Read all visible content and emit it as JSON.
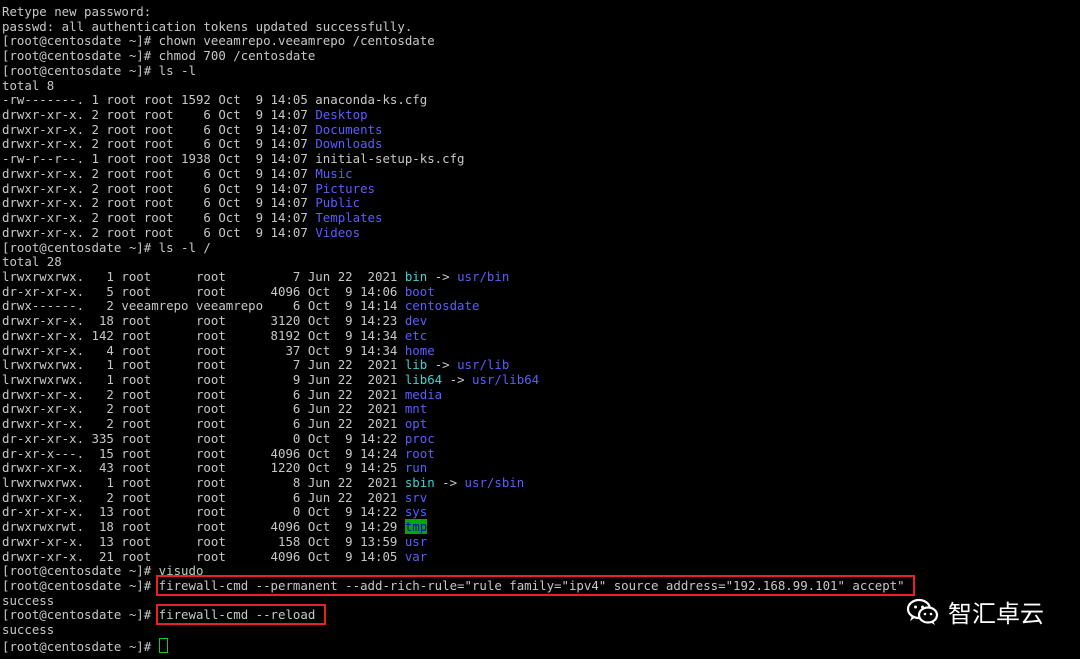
{
  "terminal": {
    "lines": [
      [
        {
          "t": "Retype new password:"
        }
      ],
      [
        {
          "t": "passwd: all authentication tokens updated successfully."
        }
      ],
      [
        {
          "t": "[root@centosdate ~]# chown veeamrepo.veeamrepo /centosdate"
        }
      ],
      [
        {
          "t": "[root@centosdate ~]# chmod 700 /centosdate"
        }
      ],
      [
        {
          "t": "[root@centosdate ~]# ls -l"
        }
      ],
      [
        {
          "t": "total 8"
        }
      ],
      [
        {
          "t": "-rw-------. 1 root root 1592 Oct  9 14:05 anaconda-ks.cfg"
        }
      ],
      [
        {
          "t": "drwxr-xr-x. 2 root root    6 Oct  9 14:07 "
        },
        {
          "t": "Desktop",
          "c": "dir"
        }
      ],
      [
        {
          "t": "drwxr-xr-x. 2 root root    6 Oct  9 14:07 "
        },
        {
          "t": "Documents",
          "c": "dir"
        }
      ],
      [
        {
          "t": "drwxr-xr-x. 2 root root    6 Oct  9 14:07 "
        },
        {
          "t": "Downloads",
          "c": "dir"
        }
      ],
      [
        {
          "t": "-rw-r--r--. 1 root root 1938 Oct  9 14:07 initial-setup-ks.cfg"
        }
      ],
      [
        {
          "t": "drwxr-xr-x. 2 root root    6 Oct  9 14:07 "
        },
        {
          "t": "Music",
          "c": "dir"
        }
      ],
      [
        {
          "t": "drwxr-xr-x. 2 root root    6 Oct  9 14:07 "
        },
        {
          "t": "Pictures",
          "c": "dir"
        }
      ],
      [
        {
          "t": "drwxr-xr-x. 2 root root    6 Oct  9 14:07 "
        },
        {
          "t": "Public",
          "c": "dir"
        }
      ],
      [
        {
          "t": "drwxr-xr-x. 2 root root    6 Oct  9 14:07 "
        },
        {
          "t": "Templates",
          "c": "dir"
        }
      ],
      [
        {
          "t": "drwxr-xr-x. 2 root root    6 Oct  9 14:07 "
        },
        {
          "t": "Videos",
          "c": "dir"
        }
      ],
      [
        {
          "t": "[root@centosdate ~]# ls -l /"
        }
      ],
      [
        {
          "t": "total 28"
        }
      ],
      [
        {
          "t": "lrwxrwxrwx.   1 root      root         7 Jun 22  2021 "
        },
        {
          "t": "bin",
          "c": "link"
        },
        {
          "t": " -> "
        },
        {
          "t": "usr/bin",
          "c": "dir"
        }
      ],
      [
        {
          "t": "dr-xr-xr-x.   5 root      root      4096 Oct  9 14:06 "
        },
        {
          "t": "boot",
          "c": "dir"
        }
      ],
      [
        {
          "t": "drwx------.   2 veeamrepo veeamrepo    6 Oct  9 14:14 "
        },
        {
          "t": "centosdate",
          "c": "dir"
        }
      ],
      [
        {
          "t": "drwxr-xr-x.  18 root      root      3120 Oct  9 14:23 "
        },
        {
          "t": "dev",
          "c": "dir"
        }
      ],
      [
        {
          "t": "drwxr-xr-x. 142 root      root      8192 Oct  9 14:34 "
        },
        {
          "t": "etc",
          "c": "dir"
        }
      ],
      [
        {
          "t": "drwxr-xr-x.   4 root      root        37 Oct  9 14:34 "
        },
        {
          "t": "home",
          "c": "dir"
        }
      ],
      [
        {
          "t": "lrwxrwxrwx.   1 root      root         7 Jun 22  2021 "
        },
        {
          "t": "lib",
          "c": "link"
        },
        {
          "t": " -> "
        },
        {
          "t": "usr/lib",
          "c": "dir"
        }
      ],
      [
        {
          "t": "lrwxrwxrwx.   1 root      root         9 Jun 22  2021 "
        },
        {
          "t": "lib64",
          "c": "link"
        },
        {
          "t": " -> "
        },
        {
          "t": "usr/lib64",
          "c": "dir"
        }
      ],
      [
        {
          "t": "drwxr-xr-x.   2 root      root         6 Jun 22  2021 "
        },
        {
          "t": "media",
          "c": "dir"
        }
      ],
      [
        {
          "t": "drwxr-xr-x.   2 root      root         6 Jun 22  2021 "
        },
        {
          "t": "mnt",
          "c": "dir"
        }
      ],
      [
        {
          "t": "drwxr-xr-x.   2 root      root         6 Jun 22  2021 "
        },
        {
          "t": "opt",
          "c": "dir"
        }
      ],
      [
        {
          "t": "dr-xr-xr-x. 335 root      root         0 Oct  9 14:22 "
        },
        {
          "t": "proc",
          "c": "dir"
        }
      ],
      [
        {
          "t": "dr-xr-x---.  15 root      root      4096 Oct  9 14:24 "
        },
        {
          "t": "root",
          "c": "dir"
        }
      ],
      [
        {
          "t": "drwxr-xr-x.  43 root      root      1220 Oct  9 14:25 "
        },
        {
          "t": "run",
          "c": "dir"
        }
      ],
      [
        {
          "t": "lrwxrwxrwx.   1 root      root         8 Jun 22  2021 "
        },
        {
          "t": "sbin",
          "c": "link"
        },
        {
          "t": " -> "
        },
        {
          "t": "usr/sbin",
          "c": "dir"
        }
      ],
      [
        {
          "t": "drwxr-xr-x.   2 root      root         6 Jun 22  2021 "
        },
        {
          "t": "srv",
          "c": "dir"
        }
      ],
      [
        {
          "t": "dr-xr-xr-x.  13 root      root         0 Oct  9 14:22 "
        },
        {
          "t": "sys",
          "c": "dir"
        }
      ],
      [
        {
          "t": "drwxrwxrwt.  18 root      root      4096 Oct  9 14:29 "
        },
        {
          "t": "tmp",
          "c": "tmp"
        }
      ],
      [
        {
          "t": "drwxr-xr-x.  13 root      root       158 Oct  9 13:59 "
        },
        {
          "t": "usr",
          "c": "dir"
        }
      ],
      [
        {
          "t": "drwxr-xr-x.  21 root      root      4096 Oct  9 14:05 "
        },
        {
          "t": "var",
          "c": "dir"
        }
      ],
      [
        {
          "t": "[root@centosdate ~]# visudo"
        }
      ],
      [
        {
          "t": "[root@centosdate ~]# "
        },
        {
          "t": "firewall-cmd --permanent --add-rich-rule=\"rule family=\"ipv4\" source address=\"192.168.99.101\" accept\" ",
          "c": "boxed"
        }
      ],
      [
        {
          "t": "success"
        }
      ],
      [
        {
          "t": "[root@centosdate ~]# "
        },
        {
          "t": "firewall-cmd --reload ",
          "c": "boxed"
        }
      ],
      [
        {
          "t": "success"
        }
      ],
      [
        {
          "t": "[root@centosdate ~]# "
        },
        {
          "t": "",
          "c": "cursor"
        }
      ]
    ]
  },
  "watermark": {
    "icon": "wechat-icon",
    "text": "智汇卓云"
  },
  "colors": {
    "background": "#000000",
    "text": "#c7c7c7",
    "directory": "#5c5cff",
    "symlink": "#3fd0d0",
    "sticky_dir_bg": "#00a800",
    "highlight_box": "#e8202a",
    "cursor": "#24c424"
  }
}
